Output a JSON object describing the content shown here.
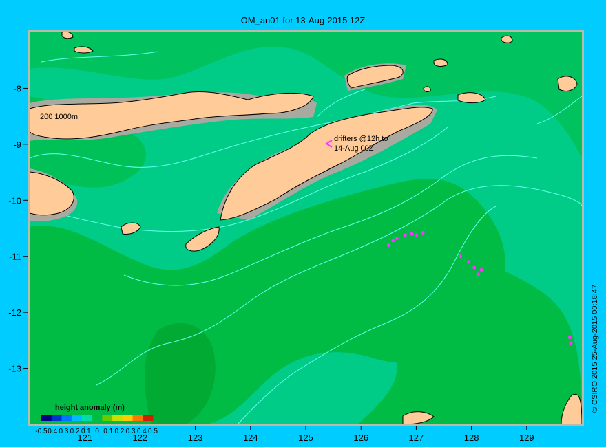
{
  "title": "OM_an01 for 13-Aug-2015 12Z",
  "credit": "© CSIRO 2015   25-Aug-2015 00:18:47",
  "contour_label": "200  1000m",
  "drifter_label_line1": "drifters @12h to",
  "drifter_label_line2": "14-Aug 00Z",
  "colorbar": {
    "title": "height anomaly (m)",
    "labels": [
      "-0.5",
      "0.4",
      "0.3",
      "0.2",
      "0.1",
      "0",
      "0.1",
      "0.2",
      "0.3",
      "0.4",
      "0.5"
    ],
    "colors": [
      "#000080",
      "#0033cc",
      "#0077ff",
      "#00bbff",
      "#00ddaa",
      "#00bb44",
      "#66cc00",
      "#ccdd00",
      "#ffcc00",
      "#ff7700",
      "#cc2200"
    ]
  },
  "x_axis": {
    "ticks": [
      121,
      122,
      123,
      124,
      125,
      126,
      127,
      128,
      129
    ],
    "range": [
      120.0,
      130.0
    ]
  },
  "y_axis": {
    "ticks": [
      -8,
      -9,
      -10,
      -11,
      -12,
      -13
    ],
    "range": [
      -14.0,
      -7.0
    ]
  },
  "colors": {
    "ocean_base": "#00cc88",
    "ocean_green": "#00bb44",
    "land": "#ffcc99",
    "shelf": "#aaa9a0",
    "contour": "#66ffee",
    "drifter": "#ff33ff",
    "frame": "#bbbbaa"
  },
  "drifters": [
    {
      "lon": 126.5,
      "lat": -10.8
    },
    {
      "lon": 126.58,
      "lat": -10.72
    },
    {
      "lon": 126.65,
      "lat": -10.68
    },
    {
      "lon": 126.8,
      "lat": -10.62
    },
    {
      "lon": 126.92,
      "lat": -10.6
    },
    {
      "lon": 127.0,
      "lat": -10.62
    },
    {
      "lon": 127.12,
      "lat": -10.58
    },
    {
      "lon": 127.8,
      "lat": -11.0
    },
    {
      "lon": 127.95,
      "lat": -11.1
    },
    {
      "lon": 128.05,
      "lat": -11.2
    },
    {
      "lon": 128.12,
      "lat": -11.32
    },
    {
      "lon": 128.18,
      "lat": -11.24
    },
    {
      "lon": 129.78,
      "lat": -12.45
    },
    {
      "lon": 129.8,
      "lat": -12.55
    }
  ]
}
